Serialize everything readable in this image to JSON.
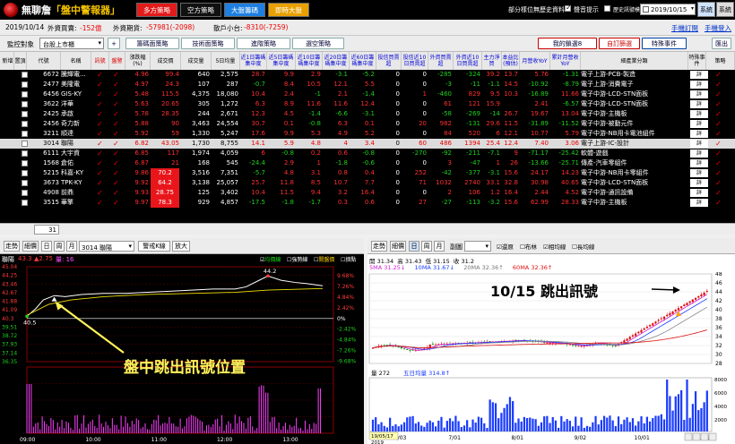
{
  "titlebar": {
    "app_name_prefix": "無聊詹",
    "app_name_main": "「盤中警報器」",
    "strategy_buttons": [
      {
        "label": "多方策略",
        "bg": "#e21b1b"
      },
      {
        "label": "空方策略",
        "bg": "#111111"
      },
      {
        "label": "大盤籌碼",
        "bg": "#1e7fe0"
      },
      {
        "label": "即時大盤",
        "bg": "#e8a000"
      }
    ],
    "right_text": "部分樣位無歷史資料",
    "sound_label": "聲音提示",
    "history_mode": "歷史訊號模式",
    "date": "2019/10/15",
    "btn1": "系統1",
    "btn2": "系統2"
  },
  "infobar": {
    "date": "2019/10/14",
    "foreign_label": "外資買賣:",
    "foreign_value": "-152億",
    "futures_label": "外資期貨:",
    "futures_value": "-57981(-2098)",
    "retail_label": "散戶小台:",
    "retail_value": "-8310(-7259)",
    "links": [
      "手機訂閱",
      "手機登入"
    ]
  },
  "toolbar": {
    "monitor_label": "監控對象",
    "monitor_value": "台股上市櫃",
    "plus": "+",
    "buttons": [
      "籌碼面策略",
      "技術面策略",
      "進階策略",
      "選空策略"
    ],
    "my_list": "我的鎖選8",
    "custom": "自訂篩選",
    "special": "特殊事件",
    "export": "匯出"
  },
  "table": {
    "headers": [
      "新增",
      "置頂",
      "代號",
      "名稱",
      "訊號",
      "盤警",
      "漲跌幅(%)",
      "成交價",
      "成交量",
      "5日均量",
      "近1日籌碼集中度",
      "近5日籌碼集中度",
      "近10日籌碼集中度",
      "近20日籌碼集中度",
      "近60日籌碼集中度",
      "投信買賣超",
      "投信近10日買賣超",
      "外資買賣超",
      "外資近10日買賣超",
      "主力淨買",
      "本益比(預估)",
      "月營收YoY",
      "累計月營收YoY",
      "細產業分類",
      "特殊事件",
      "策略"
    ],
    "rows": [
      {
        "code": "6672",
        "name": "騰輝電...",
        "chg": "4.96",
        "price": "99.4",
        "vol": "640",
        "vol5": "2,575",
        "c1": "28.7",
        "c5": "9.9",
        "c10": "2.9",
        "c20": "-3.1",
        "c60": "-5.2",
        "t1": "0",
        "t10": "0",
        "f1": "-285",
        "f10": "-324",
        "m": "39.2",
        "pe": "13.7",
        "mom": "5.76",
        "yoy": "-1.31",
        "ind": "電子上游-PCB-製造",
        "sel": false
      },
      {
        "code": "2477",
        "name": "美隆電",
        "chg": "4.97",
        "price": "24.3",
        "vol": "107",
        "vol5": "287",
        "c1": "-0.7",
        "c5": "8.4",
        "c10": "10.5",
        "c20": "12.1",
        "c60": "5.5",
        "t1": "0",
        "t10": "0",
        "f1": "-3",
        "f10": "-11",
        "m": "-1.1",
        "pe": "14.5",
        "mom": "-10.92",
        "yoy": "-8.79",
        "ind": "電子上游-消費電子",
        "sel": false
      },
      {
        "code": "6456",
        "name": "GIS-KY",
        "chg": "5.48",
        "price": "115.5",
        "vol": "4,375",
        "vol5": "18,080",
        "c1": "10.4",
        "c5": "2.4",
        "c10": "-1",
        "c20": "2.1",
        "c60": "-1.4",
        "t1": "0",
        "t10": "1",
        "f1": "-460",
        "f10": "829",
        "m": "9.5",
        "pe": "10.3",
        "mom": "-16.89",
        "yoy": "11.66",
        "ind": "電子中游-LCD-STN面板",
        "sel": false
      },
      {
        "code": "3622",
        "name": "洋華",
        "chg": "5.63",
        "price": "20.65",
        "vol": "305",
        "vol5": "1,272",
        "c1": "6.3",
        "c5": "8.9",
        "c10": "11.6",
        "c20": "11.6",
        "c60": "12.4",
        "t1": "0",
        "t10": "0",
        "f1": "61",
        "f10": "121",
        "m": "15.9",
        "pe": "",
        "mom": "2.41",
        "yoy": "-6.57",
        "ind": "電子中游-LCD-STN面板",
        "sel": false
      },
      {
        "code": "2425",
        "name": "承啟",
        "chg": "5.78",
        "price": "28.35",
        "vol": "244",
        "vol5": "2,671",
        "c1": "12.3",
        "c5": "4.5",
        "c10": "-1.4",
        "c20": "-6.6",
        "c60": "-3.1",
        "t1": "0",
        "t10": "0",
        "f1": "-58",
        "f10": "-269",
        "m": "-14",
        "pe": "26.7",
        "mom": "19.67",
        "yoy": "13.04",
        "ind": "電子中游-主機板",
        "sel": false
      },
      {
        "code": "2456",
        "name": "奇力新",
        "chg": "5.88",
        "price": "90",
        "vol": "3,463",
        "vol5": "24,554",
        "c1": "30.7",
        "c5": "0.1",
        "c10": "-0.8",
        "c20": "6.3",
        "c60": "0.1",
        "t1": "0",
        "t10": "20",
        "f1": "982",
        "f10": "-131",
        "m": "29.6",
        "pe": "11.5",
        "mom": "-31.89",
        "yoy": "-11.52",
        "ind": "電子中游-被動元件",
        "sel": false
      },
      {
        "code": "3211",
        "name": "順達",
        "chg": "5.92",
        "price": "59",
        "vol": "1,330",
        "vol5": "5,247",
        "c1": "17.6",
        "c5": "9.9",
        "c10": "5.3",
        "c20": "4.9",
        "c60": "5.2",
        "t1": "0",
        "t10": "0",
        "f1": "84",
        "f10": "520",
        "m": "6",
        "pe": "12.1",
        "mom": "10.77",
        "yoy": "5.79",
        "ind": "電子中游-NB用卡電池組件",
        "sel": false
      },
      {
        "code": "3014",
        "name": "聯陽",
        "chg": "6.82",
        "price": "43.05",
        "vol": "1,730",
        "vol5": "8,755",
        "c1": "14.1",
        "c5": "5.9",
        "c10": "4.8",
        "c20": "4",
        "c60": "3.4",
        "t1": "0",
        "t10": "60",
        "f1": "486",
        "f10": "1394",
        "m": "25.4",
        "pe": "12.4",
        "mom": "7.40",
        "yoy": "3.06",
        "ind": "電子上游-IC-設計",
        "sel": true
      },
      {
        "code": "6111",
        "name": "大宇資",
        "chg": "6.85",
        "price": "117",
        "vol": "1,974",
        "vol5": "4,059",
        "c1": "6",
        "c5": "-0.8",
        "c10": "0.2",
        "c20": "0.6",
        "c60": "-0.8",
        "t1": "0",
        "t10": "-270",
        "f1": "-92",
        "f10": "-211",
        "m": "-7.1",
        "pe": "9",
        "mom": "-71.17",
        "yoy": "-25.42",
        "ind": "軟體-遊戲",
        "sel": false
      },
      {
        "code": "1568",
        "name": "倉佑",
        "chg": "6.87",
        "price": "21",
        "vol": "168",
        "vol5": "545",
        "c1": "-24.4",
        "c5": "2.9",
        "c10": "1",
        "c20": "-1.8",
        "c60": "-0.6",
        "t1": "0",
        "t10": "0",
        "f1": "3",
        "f10": "-47",
        "m": "1",
        "pe": "26",
        "mom": "-13.66",
        "yoy": "-25.71",
        "ind": "傳產-汽車零組件",
        "sel": false
      },
      {
        "code": "5215",
        "name": "科嘉-KY",
        "chg": "9.86",
        "price": "70.2",
        "vol": "3,516",
        "vol5": "7,351",
        "c1": "-5.7",
        "c5": "4.8",
        "c10": "3.1",
        "c20": "0.8",
        "c60": "0.4",
        "t1": "0",
        "t10": "252",
        "f1": "-42",
        "f10": "-377",
        "m": "-3.1",
        "pe": "15.6",
        "mom": "24.17",
        "yoy": "14.23",
        "ind": "電子中游-NB用卡零組件",
        "sel": false
      },
      {
        "code": "3673",
        "name": "TPK-KY",
        "chg": "9.92",
        "price": "64.2",
        "vol": "3,138",
        "vol5": "25,057",
        "c1": "25.7",
        "c5": "11.8",
        "c10": "8.5",
        "c20": "10.7",
        "c60": "7.7",
        "t1": "0",
        "t10": "71",
        "f1": "1032",
        "f10": "2740",
        "m": "33.1",
        "pe": "32.8",
        "mom": "30.98",
        "yoy": "40.65",
        "ind": "電子中游-LCD-STN面板",
        "sel": false
      },
      {
        "code": "4908",
        "name": "前鼎",
        "chg": "9.93",
        "price": "28.75",
        "vol": "125",
        "vol5": "3,402",
        "c1": "10.4",
        "c5": "11.5",
        "c10": "9.4",
        "c20": "3.2",
        "c60": "16.4",
        "t1": "0",
        "t10": "0",
        "f1": "2",
        "f10": "106",
        "m": "1.2",
        "pe": "16.4",
        "mom": "2.44",
        "yoy": "4.52",
        "ind": "電子中游-通訊設備",
        "sel": false
      },
      {
        "code": "3515",
        "name": "華擎",
        "chg": "9.97",
        "price": "78.3",
        "vol": "929",
        "vol5": "4,857",
        "c1": "-17.5",
        "c5": "-1.8",
        "c10": "-1.7",
        "c20": "0.3",
        "c60": "0.6",
        "t1": "0",
        "t10": "27",
        "f1": "-27",
        "f10": "-113",
        "m": "-3.2",
        "pe": "15.6",
        "mom": "62.99",
        "yoy": "28.33",
        "ind": "電子中游-主機板",
        "sel": false
      }
    ],
    "count": "31"
  },
  "leftpane": {
    "tabs": [
      "走勢",
      "細價",
      "日",
      "周",
      "月"
    ],
    "stock": "3014 聯陽",
    "btn1": "警戒K線",
    "btn2": "放大",
    "checks": [
      "均價線",
      "強勢線",
      "開盤價",
      "擠點"
    ],
    "stock_name": "聯陽",
    "last_price": "43.3",
    "change": "2.75",
    "vol": "16",
    "annotation": "盤中跳出訊號位置",
    "price_labels": [
      "45.04",
      "44.25",
      "43.46",
      "42.67",
      "41.88",
      "41.09",
      "40.3",
      "39.51",
      "38.72",
      "37.93",
      "37.14",
      "36.35"
    ],
    "pct_labels": [
      "9.68%",
      "7.26%",
      "4.84%",
      "2.42%",
      "0%",
      "-2.42%",
      "-4.84%",
      "-7.26%",
      "-9.68%"
    ],
    "high_label": "44.2",
    "low_label": "40.5",
    "time_labels": [
      "09:00",
      "10:00",
      "11:00",
      "12:00",
      "13:00"
    ]
  },
  "rightpane": {
    "tabs": [
      "走勢",
      "細價",
      "日",
      "周",
      "月"
    ],
    "period_label": "副圖",
    "checks": [
      "還原",
      "布林",
      "相均線",
      "長均線"
    ],
    "ohlc_text": "開 31.34  高 31.43  低 31.15  收 31.2",
    "ma_labels": [
      {
        "text": "5MA 31.25↓",
        "color": "#d020d0"
      },
      {
        "text": "10MA 31.67↓",
        "color": "#1a3cff"
      },
      {
        "text": "20MA 32.36↑",
        "color": "#777777"
      },
      {
        "text": "60MA 32.36↑",
        "color": "#e01010"
      }
    ],
    "annotation": "10/15  跳出訊號",
    "price_axis": [
      "48",
      "46",
      "44",
      "42",
      "40",
      "38",
      "36",
      "34",
      "32",
      "30",
      "28"
    ],
    "vol_label": "量 272",
    "vol5_label": "五日均量 314.8↑",
    "vol_axis": [
      "8000",
      "6000",
      "4000",
      "2000"
    ],
    "date_labels": [
      "6/03",
      "7/01",
      "8/01",
      "9/02",
      "10/01",
      "11/01"
    ],
    "year": "2019",
    "start_date": "19/05/17"
  }
}
